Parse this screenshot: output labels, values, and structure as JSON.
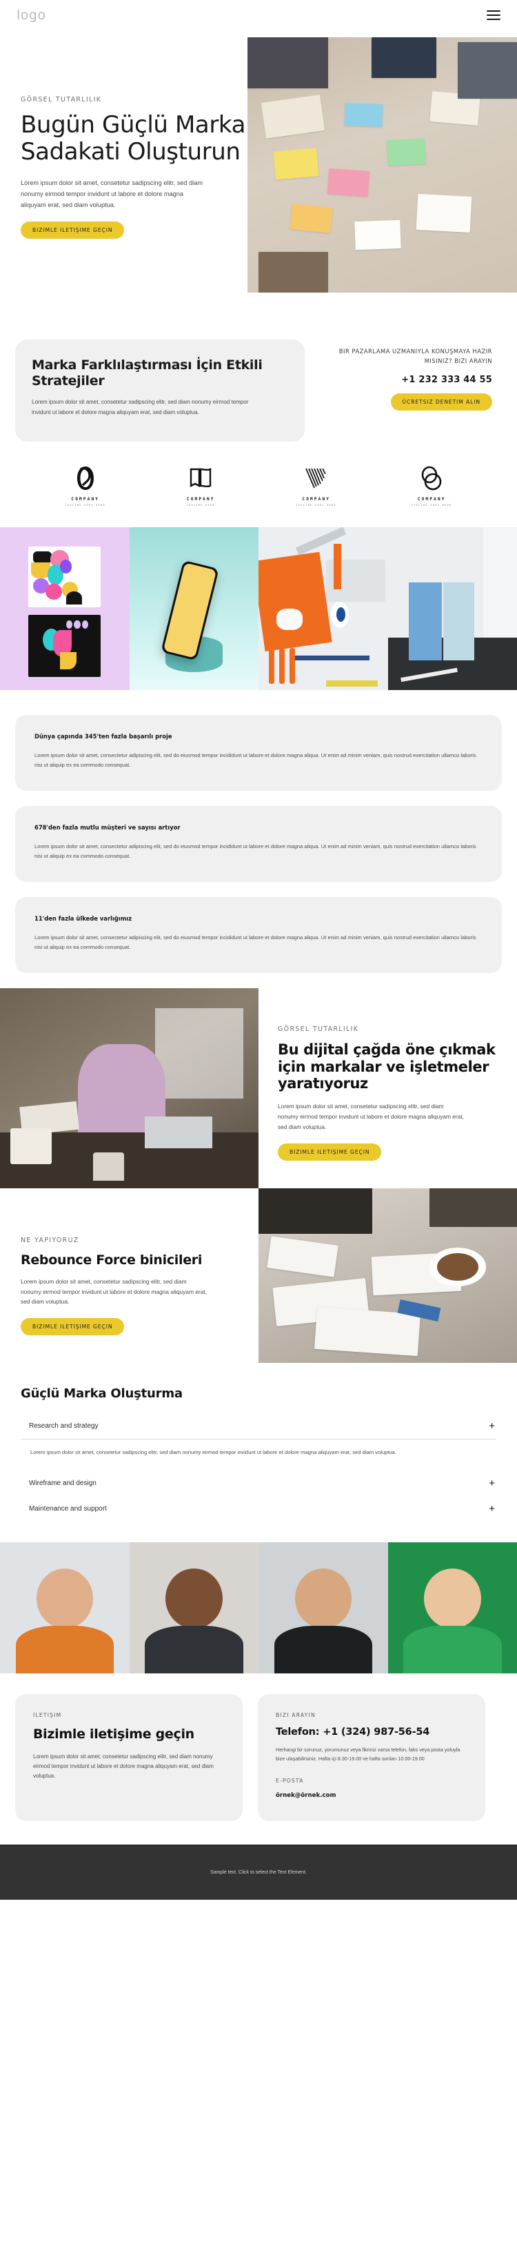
{
  "header": {
    "logo": "logo",
    "menu_icon": "hamburger-menu-icon"
  },
  "hero": {
    "eyebrow": "GÖRSEL TUTARLILIK",
    "title": "Bugün Güçlü Marka Sadakati Oluşturun",
    "paragraph": "Lorem ipsum dolor sit amet, consetetur sadipscing elitr, sed diam nonumy eirmod tempor invidunt ut labore et dolore magna aliquyam erat, sed diam voluptua.",
    "cta": "BIZIMLE ILETIŞIME GEÇIN",
    "image": "brainstorming-table-with-sticky-notes"
  },
  "strategy": {
    "title": "Marka Farklılaştırması İçin Etkili Stratejiler",
    "paragraph": "Lorem ipsum dolor sit amet, consetetur sadipscing elitr, sed diam nonumy eirmod tempor invidunt ut labore et dolore magna aliquyam erat, sed diam voluptua.",
    "callout": "BIR PAZARLAMA UZMANIYLA KONUŞMAYA HAZIR MISINIZ? BIZI ARAYIN",
    "phone": "+1 232 333 44 55",
    "cta": "ÜCRETSIZ DENETIM ALIN"
  },
  "logos": [
    {
      "name": "COMPANY",
      "tagline": "TAGLINE GOES HERE",
      "mark": "infinity-loop-logo-icon"
    },
    {
      "name": "COMPANY",
      "tagline": "TAGLINE HERE",
      "mark": "open-book-logo-icon"
    },
    {
      "name": "COMPANY",
      "tagline": "TAGLINE GOES HERE",
      "mark": "striped-v-logo-icon"
    },
    {
      "name": "COMPANY",
      "tagline": "TAGLINE GOES HERE",
      "mark": "double-ring-logo-icon"
    }
  ],
  "gallery": [
    {
      "label": "brand-identity-cards-mockup"
    },
    {
      "label": "phone-on-podium-mockup"
    },
    {
      "label": "orange-desk-stationery-flatlay"
    },
    {
      "label": "blue-paper-cards-mockup"
    }
  ],
  "cards": [
    {
      "title": "Dünya çapında 345'ten fazla başarılı proje",
      "text": "Lorem ipsum dolor sit amet, consectetur adipiscing elit, sed do eiusmod tempor incididunt ut labore et dolore magna aliqua. Ut enim ad minim veniam, quis nostrud exercitation ullamco laboris nisi ut aliquip ex ea commodo consequat."
    },
    {
      "title": "678'den fazla mutlu müşteri ve sayısı artıyor",
      "text": "Lorem ipsum dolor sit amet, consectetur adipiscing elit, sed do eiusmod tempor incididunt ut labore et dolore magna aliqua. Ut enim ad minim veniam, quis nostrud exercitation ullamco laboris nisi ut aliquip ex ea commodo consequat."
    },
    {
      "title": "11'den fazla ülkede varlığımız",
      "text": "Lorem ipsum dolor sit amet, consectetur adipiscing elit, sed do eiusmod tempor incididunt ut labore et dolore magna aliqua. Ut enim ad minim veniam, quis nostrud exercitation ullamco laboris nisi ut aliquip ex ea commodo consequat."
    }
  ],
  "digital": {
    "eyebrow": "GÖRSEL TUTARLILIK",
    "title": "Bu dijital çağda öne çıkmak için markalar ve işletmeler yaratıyoruz",
    "paragraph": "Lorem ipsum dolor sit amet, consetetur sadipscing elitr, sed diam nonumy eirmod tempor invidunt ut labore et dolore magna aliquyam erat, sed diam voluptua.",
    "cta": "BIZIMLE ILETIŞIME GEÇIN",
    "image": "woman-working-in-office"
  },
  "rebounce": {
    "eyebrow": "NE YAPIYORUZ",
    "title": "Rebounce Force binicileri",
    "paragraph": "Lorem ipsum dolor sit amet, consetetur sadipscing elitr, sed diam nonumy eirmod tempor invidunt ut labore et dolore magna aliquyam erat, sed diam voluptua.",
    "cta": "BIZIMLE ILETIŞIME GEÇIN",
    "image": "team-meeting-with-documents-and-coffee"
  },
  "accordion": {
    "heading": "Güçlü Marka Oluşturma",
    "items": [
      {
        "label": "Research and strategy",
        "icon": "plus-icon",
        "expanded": true,
        "body": "Lorem ipsum dolor sit amet, consetetur sadipscing elitr, sed diam nonumy eirmod tempor invidunt ut labore et dolore magna aliquyam erat, sed diam voluptua."
      },
      {
        "label": "Wireframe and design",
        "icon": "plus-icon",
        "expanded": false,
        "body": ""
      },
      {
        "label": "Maintenance and support",
        "icon": "plus-icon",
        "expanded": false,
        "body": ""
      }
    ]
  },
  "people": [
    {
      "label": "smiling-man-in-orange-shirt-portrait"
    },
    {
      "label": "smiling-woman-with-glasses-portrait"
    },
    {
      "label": "bearded-man-portrait"
    },
    {
      "label": "blonde-woman-in-green-sweater-portrait"
    }
  ],
  "contact": {
    "eyebrow": "İLETIŞIM",
    "title": "Bizimle iletişime geçin",
    "paragraph": "Lorem ipsum dolor sit amet, consetetur sadipscing elitr, sed diam nonumy eirmod tempor invidunt ut labore et dolore magna aliquyam erat, sed diam voluptua.",
    "call_eyebrow": "BIZI ARAYIN",
    "phone": "Telefon: +1 (324) 987-56-54",
    "hours": "Herhangi bir sorunuz, yorumunuz veya fikriniz varsa telefon, faks veya posta yoluyla bize ulaşabilirsiniz. Hafta içi 8.30-19.00 ve hafta sonları 10.00-19.00",
    "email_eyebrow": "E-POSTA",
    "email": "örnek@örnek.com"
  },
  "footer": {
    "text": "Sample text. Click to select the Text Element."
  },
  "colors": {
    "accent": "#ecc92a",
    "card_bg": "#f0f0f0",
    "footer_bg": "#333333",
    "text": "#1a1a1a"
  }
}
